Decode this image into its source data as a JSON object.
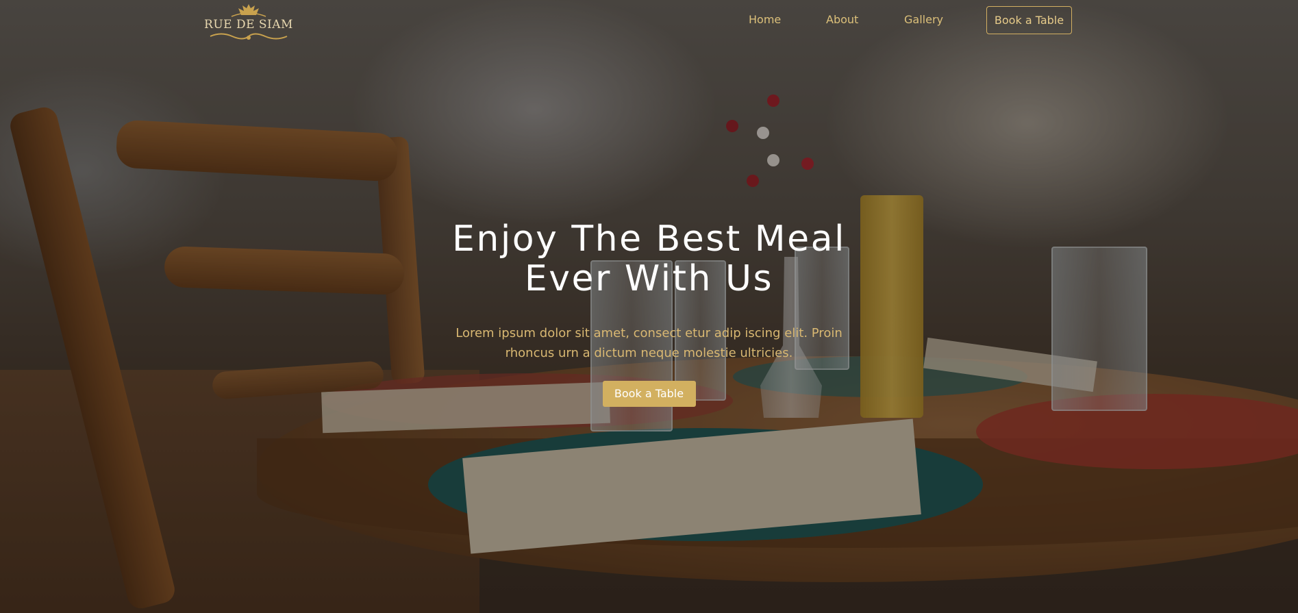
{
  "brand": {
    "logo_text": "RUE DE SIAM"
  },
  "nav": {
    "links": [
      {
        "label": "Home"
      },
      {
        "label": "About"
      },
      {
        "label": "Gallery"
      }
    ],
    "cta_label": "Book a Table"
  },
  "hero": {
    "title_line1": "Enjoy The Best Meal",
    "title_line2": "Ever With Us",
    "subtitle": "Lorem ipsum dolor sit amet, consect etur adip iscing elit. Proin rhoncus urn a dictum neque molestie ultricies.",
    "cta_label": "Book a Table"
  },
  "colors": {
    "accent": "#d2b060",
    "nav_text": "#dcc07a",
    "title_text": "#ffffff"
  }
}
